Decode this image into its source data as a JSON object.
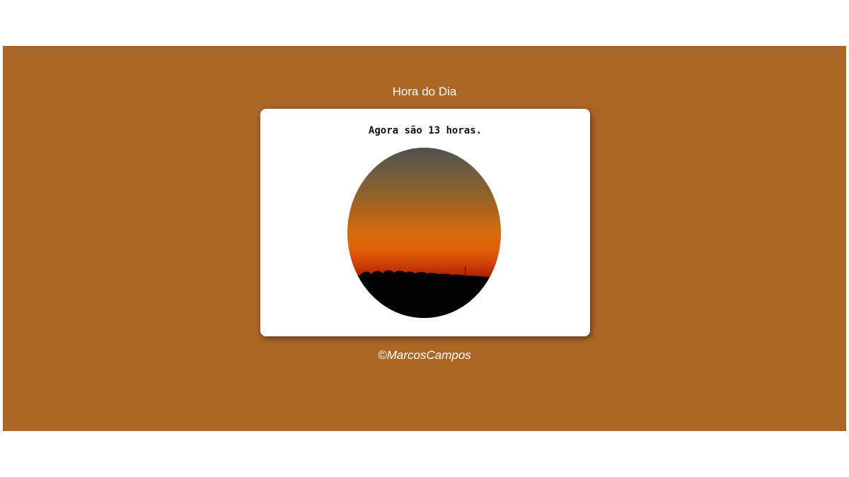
{
  "header": {
    "title": "Hora do Dia"
  },
  "card": {
    "message": "Agora são 13 horas.",
    "image_icon": "sunset-landscape-image"
  },
  "footer": {
    "credit": "©MarcosCampos"
  },
  "colors": {
    "background": "#ac6628",
    "card": "#ffffff",
    "title_text": "#ffffff",
    "message_text": "#111111"
  }
}
